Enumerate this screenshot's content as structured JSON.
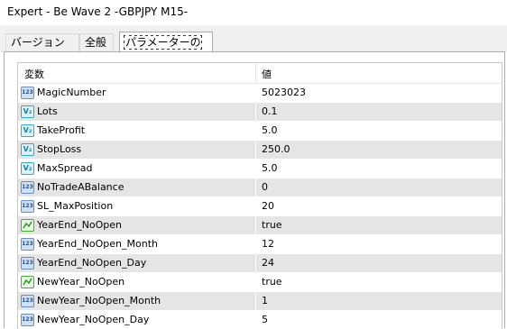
{
  "window": {
    "title": "Expert - Be Wave 2 -GBPJPY M15-"
  },
  "tabs": [
    {
      "label": "バージョン情報"
    },
    {
      "label": "全般"
    },
    {
      "label": "パラメーターの入力"
    }
  ],
  "table": {
    "headers": {
      "variable": "変数",
      "value": "値"
    },
    "rows": [
      {
        "icon": "integer-icon",
        "name": "MagicNumber",
        "value": "5023023"
      },
      {
        "icon": "double-icon",
        "name": "Lots",
        "value": "0.1"
      },
      {
        "icon": "double-icon",
        "name": "TakeProfit",
        "value": "5.0"
      },
      {
        "icon": "double-icon",
        "name": "StopLoss",
        "value": "250.0"
      },
      {
        "icon": "double-icon",
        "name": "MaxSpread",
        "value": "5.0"
      },
      {
        "icon": "integer-icon",
        "name": "NoTradeABalance",
        "value": "0"
      },
      {
        "icon": "integer-icon",
        "name": "SL_MaxPosition",
        "value": "20"
      },
      {
        "icon": "boolean-icon",
        "name": "YearEnd_NoOpen",
        "value": "true"
      },
      {
        "icon": "integer-icon",
        "name": "YearEnd_NoOpen_Month",
        "value": "12"
      },
      {
        "icon": "integer-icon",
        "name": "YearEnd_NoOpen_Day",
        "value": "24"
      },
      {
        "icon": "boolean-icon",
        "name": "NewYear_NoOpen",
        "value": "true"
      },
      {
        "icon": "integer-icon",
        "name": "NewYear_NoOpen_Month",
        "value": "1"
      },
      {
        "icon": "integer-icon",
        "name": "NewYear_NoOpen_Day",
        "value": "5"
      }
    ]
  }
}
